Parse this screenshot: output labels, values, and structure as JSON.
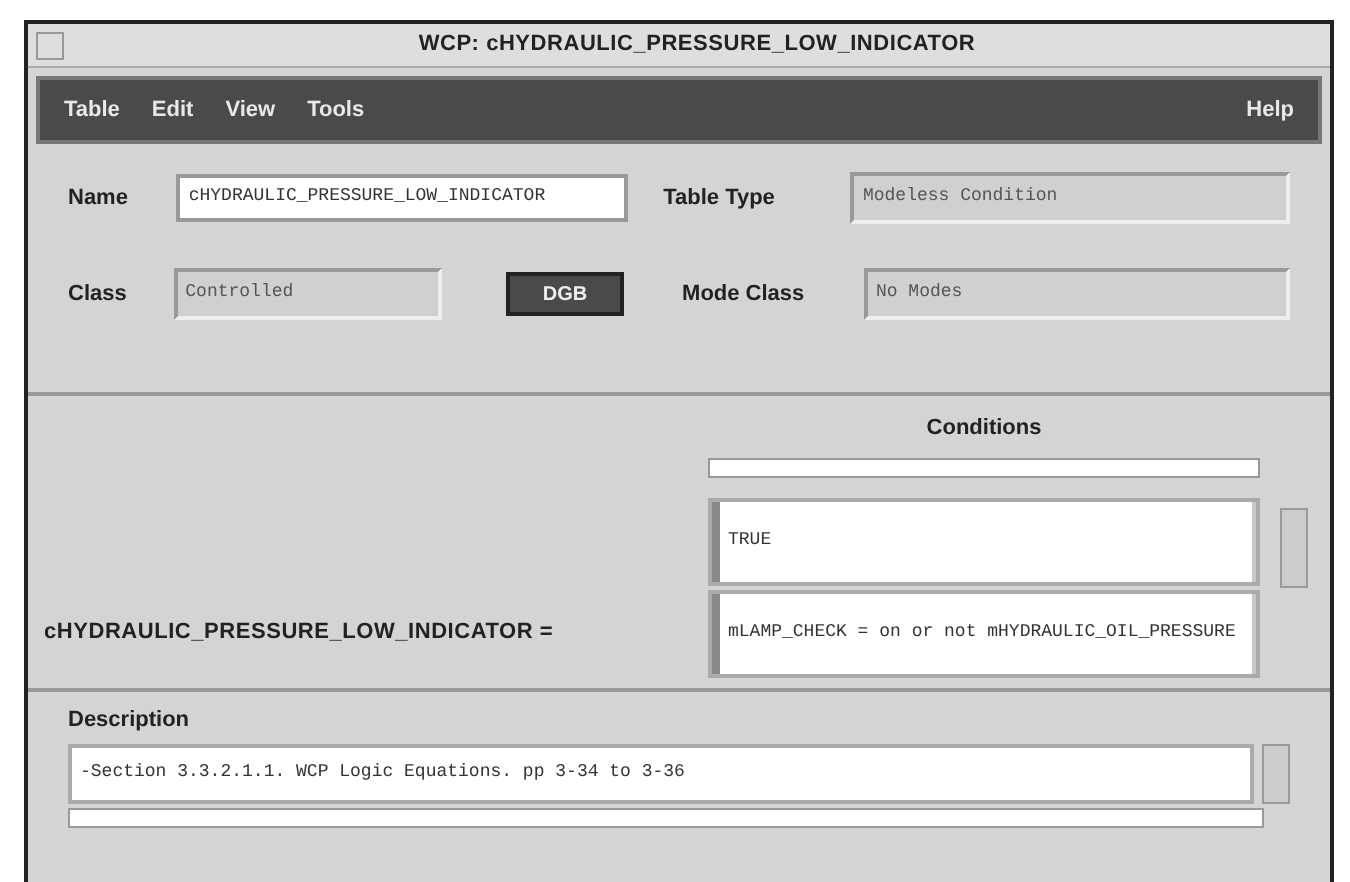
{
  "window": {
    "title": "WCP: cHYDRAULIC_PRESSURE_LOW_INDICATOR"
  },
  "menu": {
    "left": [
      "Table",
      "Edit",
      "View",
      "Tools"
    ],
    "right": [
      "Help"
    ]
  },
  "fields": {
    "name_label": "Name",
    "name": "cHYDRAULIC_PRESSURE_LOW_INDICATOR",
    "table_type_label": "Table Type",
    "table_type": "Modeless Condition",
    "class_label": "Class",
    "class": "Controlled",
    "button": "DGB",
    "mode_class_label": "Mode Class",
    "mode_class": "No Modes"
  },
  "conditions": {
    "heading": "Conditions",
    "variable": "cHYDRAULIC_PRESSURE_LOW_INDICATOR =",
    "cells": [
      "TRUE",
      "mLAMP_CHECK = on or not mHYDRAULIC_OIL_PRESSURE"
    ]
  },
  "description": {
    "label": "Description",
    "text": "-Section 3.3.2.1.1. WCP Logic Equations. pp 3-34 to 3-36"
  }
}
